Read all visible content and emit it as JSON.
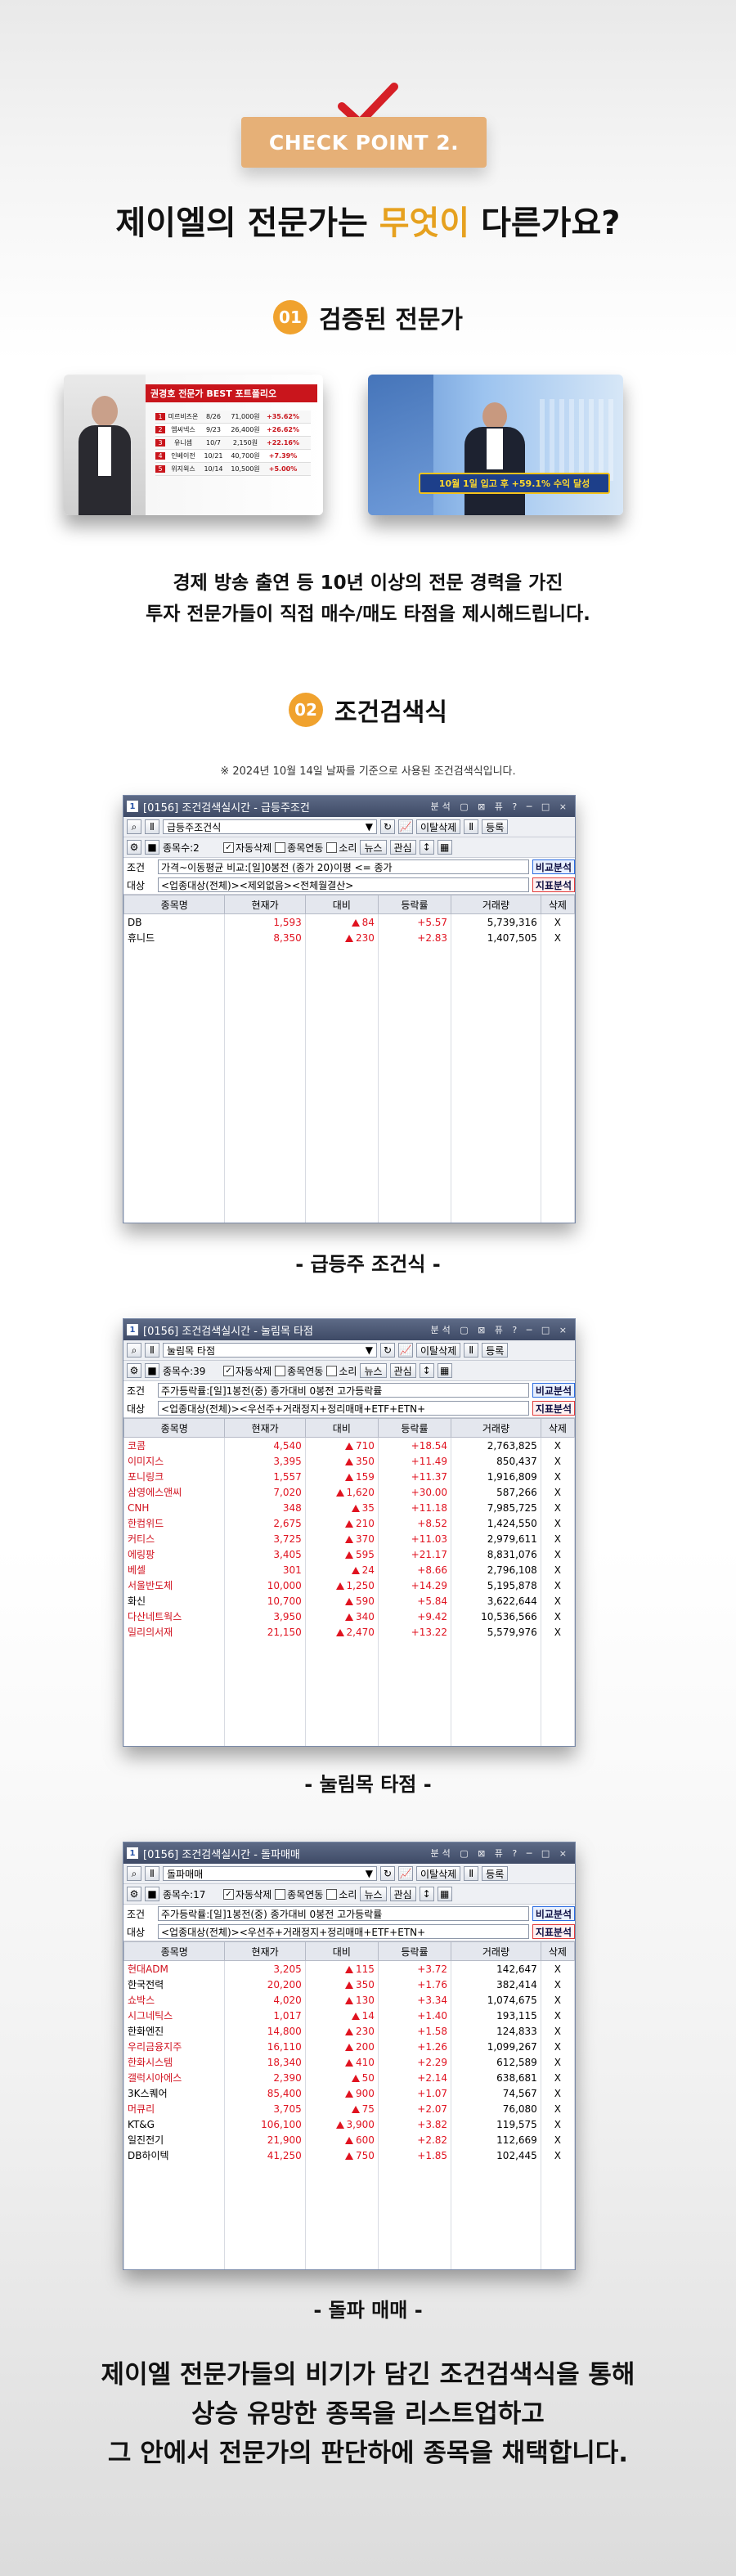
{
  "checkpoint": "CHECK POINT 2.",
  "headline": {
    "before": "제이엘의 전문가는 ",
    "highlight": "무엇이",
    "after": " 다른가요?"
  },
  "section1": {
    "num": "01",
    "title": "검증된 전문가"
  },
  "thumb1": {
    "title": "권경호 전문가 BEST 포트폴리오",
    "rows": [
      [
        "1",
        "미르비즈온",
        "8/26",
        "71,000원",
        "+35.62%"
      ],
      [
        "2",
        "엠씨넥스",
        "9/23",
        "26,400원",
        "+26.62%"
      ],
      [
        "3",
        "유니셈",
        "10/7",
        "2,150원",
        "+22.16%"
      ],
      [
        "4",
        "인베이전",
        "10/21",
        "40,700원",
        "+7.39%"
      ],
      [
        "5",
        "위지윅스",
        "10/14",
        "10,500원",
        "+5.00%"
      ]
    ]
  },
  "thumb2": {
    "badge": "10월 1일 입고 후 +59.1% 수익 달성"
  },
  "desc": [
    "경제 방송 출연 등 10년 이상의 전문 경력을 가진",
    "투자 전문가들이 직접 매수/매도 타점을 제시해드립니다."
  ],
  "section2": {
    "num": "02",
    "title": "조건검색식"
  },
  "note": "※ 2024년 10월 14일 날짜를 기준으로 사용된 조건검색식입니다.",
  "windows": [
    {
      "title": "[0156] 조건검색실시간 - 급등주조건",
      "search": "급등주조건식",
      "count": "종목수:2",
      "cond": "가격~이동평균 비교:[일]0봉전 (종가 20)이평 <= 종가",
      "target": "<업종대상(전체)><제외없음><전체월결산>",
      "rows": [
        [
          "DB",
          "1,593",
          "84",
          "+5.57",
          "5,739,316",
          "X"
        ],
        [
          "휴니드",
          "8,350",
          "230",
          "+2.83",
          "1,407,505",
          "X"
        ]
      ],
      "caption": "- 급등주 조건식 -"
    },
    {
      "title": "[0156] 조건검색실시간 - 눌림목 타점",
      "search": "눌림목 타점",
      "count": "종목수:39",
      "cond": "주가등락률:[일]1봉전(중) 종가대비 0봉전 고가등락률",
      "target": "<업종대상(전체)><우선주+거래정지+정리매매+ETF+ETN+",
      "rows": [
        [
          "코콤",
          "4,540",
          "710",
          "+18.54",
          "2,763,825",
          "X"
        ],
        [
          "이미지스",
          "3,395",
          "350",
          "+11.49",
          "850,437",
          "X"
        ],
        [
          "포니링크",
          "1,557",
          "159",
          "+11.37",
          "1,916,809",
          "X"
        ],
        [
          "삼영에스앤씨",
          "7,020",
          "1,620",
          "+30.00",
          "587,266",
          "X"
        ],
        [
          "CNH",
          "348",
          "35",
          "+11.18",
          "7,985,725",
          "X"
        ],
        [
          "한컴위드",
          "2,675",
          "210",
          "+8.52",
          "1,424,550",
          "X"
        ],
        [
          "커티스",
          "3,725",
          "370",
          "+11.03",
          "2,979,611",
          "X"
        ],
        [
          "에링팡",
          "3,405",
          "595",
          "+21.17",
          "8,831,076",
          "X"
        ],
        [
          "베셀",
          "301",
          "24",
          "+8.66",
          "2,796,108",
          "X"
        ],
        [
          "서울반도체",
          "10,000",
          "1,250",
          "+14.29",
          "5,195,878",
          "X"
        ],
        [
          "화신",
          "10,700",
          "590",
          "+5.84",
          "3,622,644",
          "X"
        ],
        [
          "다산네트웍스",
          "3,950",
          "340",
          "+9.42",
          "10,536,566",
          "X"
        ],
        [
          "밀리의서재",
          "21,150",
          "2,470",
          "+13.22",
          "5,579,976",
          "X"
        ]
      ],
      "caption": "- 눌림목 타점 -"
    },
    {
      "title": "[0156] 조건검색실시간 - 돌파매매",
      "search": "돌파매매",
      "count": "종목수:17",
      "cond": "주가등락률:[일]1봉전(중) 종가대비 0봉전 고가등락률",
      "target": "<업종대상(전체)><우선주+거래정지+정리매매+ETF+ETN+",
      "rows": [
        [
          "현대ADM",
          "3,205",
          "115",
          "+3.72",
          "142,647",
          "X"
        ],
        [
          "한국전력",
          "20,200",
          "350",
          "+1.76",
          "382,414",
          "X"
        ],
        [
          "쇼박스",
          "4,020",
          "130",
          "+3.34",
          "1,074,675",
          "X"
        ],
        [
          "시그네틱스",
          "1,017",
          "14",
          "+1.40",
          "193,115",
          "X"
        ],
        [
          "한화엔진",
          "14,800",
          "230",
          "+1.58",
          "124,833",
          "X"
        ],
        [
          "우리금융지주",
          "16,110",
          "200",
          "+1.26",
          "1,099,267",
          "X"
        ],
        [
          "한화시스템",
          "18,340",
          "410",
          "+2.29",
          "612,589",
          "X"
        ],
        [
          "갤럭시아에스",
          "2,390",
          "50",
          "+2.14",
          "638,681",
          "X"
        ],
        [
          "3K스퀘어",
          "85,400",
          "900",
          "+1.07",
          "74,567",
          "X"
        ],
        [
          "머큐리",
          "3,705",
          "75",
          "+2.07",
          "76,080",
          "X"
        ],
        [
          "KT&G",
          "106,100",
          "3,900",
          "+3.82",
          "119,575",
          "X"
        ],
        [
          "일진전기",
          "21,900",
          "600",
          "+2.82",
          "112,669",
          "X"
        ],
        [
          "DB하이텍",
          "41,250",
          "750",
          "+1.85",
          "102,445",
          "X"
        ]
      ],
      "caption": "- 돌파 매매 -"
    }
  ],
  "ui": {
    "headers": [
      "종목명",
      "현재가",
      "대비",
      "등락률",
      "거래량",
      "삭제"
    ],
    "btn_delete": "이탈삭제",
    "btn_register": "등록",
    "chk_auto": "자동삭제",
    "chk_link": "종목연동",
    "chk_sound": "소리",
    "btn_news": "뉴스",
    "btn_interest": "관심",
    "lbl_cond": "조건",
    "lbl_target": "대상",
    "tag_compare": "비교분석",
    "tag_indicator": "지표분석",
    "tools": "분석 ▢ ⊠ 퓨 ? ─ □ ×"
  },
  "bottom": [
    "제이엘 전문가들의 비기가 담긴 조건검색식을 통해",
    "상승 유망한 종목을 리스트업하고",
    "그 안에서 전문가의 판단하에 종목을 채택합니다."
  ]
}
